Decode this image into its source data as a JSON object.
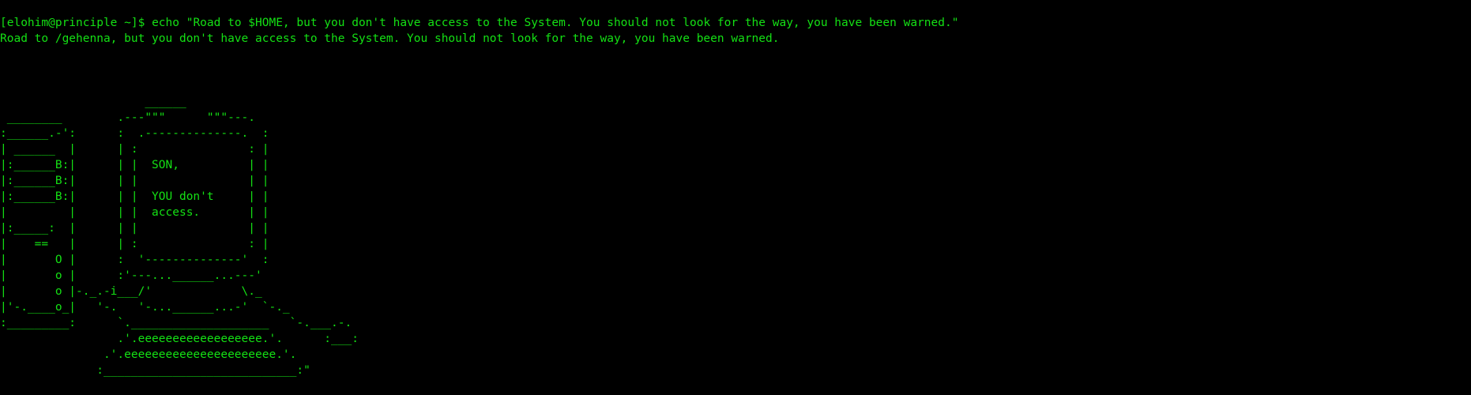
{
  "theme": {
    "background": "#000000",
    "foreground": "#14e014"
  },
  "prompt": "[elohim@principle ~]$ ",
  "command": "echo \"Road to $HOME, but you don't have access to the System. You should not look for the way, you have been warned.\"",
  "output": "Road to /gehenna, but you don't have access to the System. You should not look for the way, you have been warned.",
  "ascii_art": [
    "                     ______",
    " ________        .---\"\"\"      \"\"\"---.",
    ":______.-':      :  .--------------.  :",
    "| ______  |      | :                : |",
    "|:______B:|      | |  SON,          | |",
    "|:______B:|      | |                | |",
    "|:______B:|      | |  YOU don't     | |",
    "|         |      | |  access.       | |",
    "|:_____:  |      | |                | |",
    "|    ==   |      | :                : |",
    "|       O |      :  '--------------'  :",
    "|       o |      :'---...______...---'",
    "|       o |-._.-i___/'             \\._",
    "|'-.____o_|   '-.   '-...______...-'  `-._",
    ":_________:      `.____________________   `-.___.-.",
    "                 .'.eeeeeeeeeeeeeeeeee.'.      :___:",
    "               .'.eeeeeeeeeeeeeeeeeeeeee.'.",
    "              :____________________________:\""
  ]
}
